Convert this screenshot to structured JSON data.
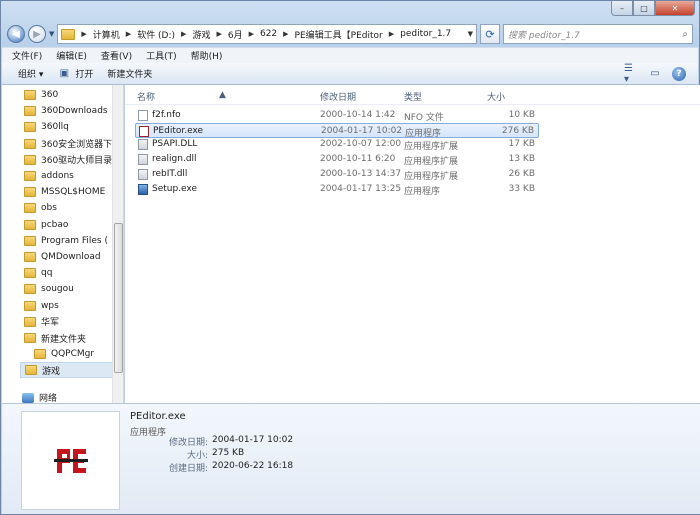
{
  "window": {
    "caption_minimize": "–",
    "caption_maximize": "□",
    "caption_close": "✕"
  },
  "address": {
    "breadcrumbs": [
      "计算机",
      "软件 (D:)",
      "游戏",
      "6月",
      "622",
      "PE编辑工具【PEditor",
      "peditor_1.7"
    ],
    "search_placeholder": "搜索 peditor_1.7"
  },
  "menu": [
    "文件(F)",
    "编辑(E)",
    "查看(V)",
    "工具(T)",
    "帮助(H)"
  ],
  "toolbar": {
    "organize": "组织 ▾",
    "open": "打开",
    "new_folder": "新建文件夹"
  },
  "nav": {
    "items": [
      "360",
      "360Downloads",
      "360llq",
      "360安全浏览器下",
      "360驱动大师目录",
      "addons",
      "MSSQL$HOME",
      "obs",
      "pcbao",
      "Program Files (",
      "QMDownload",
      "qq",
      "sougou",
      "wps",
      "华军",
      "新建文件夹",
      "QQPCMgr",
      "游戏"
    ],
    "selected_index": 17,
    "network": "网络"
  },
  "columns": {
    "name": "名称",
    "date": "修改日期",
    "type": "类型",
    "size": "大小"
  },
  "files": [
    {
      "name": "f2f.nfo",
      "date": "2000-10-14 1:42",
      "type": "NFO 文件",
      "size": "10 KB",
      "icon": "document-icon"
    },
    {
      "name": "PEditor.exe",
      "date": "2004-01-17 10:02",
      "type": "应用程序",
      "size": "276 KB",
      "icon": "peditor-icon"
    },
    {
      "name": "PSAPI.DLL",
      "date": "2002-10-07 12:00",
      "type": "应用程序扩展",
      "size": "17 KB",
      "icon": "dll-icon"
    },
    {
      "name": "realign.dll",
      "date": "2000-10-11 6:20",
      "type": "应用程序扩展",
      "size": "13 KB",
      "icon": "dll-icon"
    },
    {
      "name": "rebIT.dll",
      "date": "2000-10-13 14:37",
      "type": "应用程序扩展",
      "size": "26 KB",
      "icon": "dll-icon"
    },
    {
      "name": "Setup.exe",
      "date": "2004-01-17 13:25",
      "type": "应用程序",
      "size": "33 KB",
      "icon": "setup-icon"
    }
  ],
  "selected_file_index": 1,
  "details": {
    "name": "PEditor.exe",
    "type": "应用程序",
    "modified_label": "修改日期:",
    "modified": "2004-01-17 10:02",
    "size_label": "大小:",
    "size": "275 KB",
    "created_label": "创建日期:",
    "created": "2020-06-22 16:18"
  }
}
